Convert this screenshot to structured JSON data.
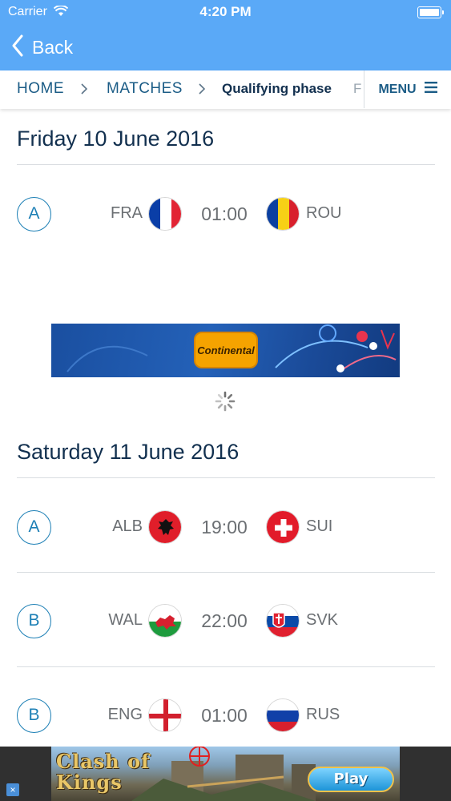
{
  "status_bar": {
    "carrier": "Carrier",
    "time": "4:20 PM"
  },
  "nav": {
    "back_label": "Back"
  },
  "breadcrumb": {
    "items": [
      "HOME",
      "MATCHES",
      "Qualifying phase",
      "F"
    ],
    "menu_label": "MENU"
  },
  "days": [
    {
      "date": "Friday 10 June 2016",
      "matches": [
        {
          "group": "A",
          "home": "FRA",
          "time": "01:00",
          "away": "ROU"
        }
      ]
    },
    {
      "date": "Saturday 11 June 2016",
      "matches": [
        {
          "group": "A",
          "home": "ALB",
          "time": "19:00",
          "away": "SUI"
        },
        {
          "group": "B",
          "home": "WAL",
          "time": "22:00",
          "away": "SVK"
        },
        {
          "group": "B",
          "home": "ENG",
          "time": "01:00",
          "away": "RUS"
        }
      ]
    }
  ],
  "ads": {
    "banner_top": {
      "brand": "Continental"
    },
    "banner_bottom": {
      "title": "Clash of Kings",
      "cta": "Play"
    }
  },
  "colors": {
    "accent": "#5aa9f7",
    "group_badge": "#1c7fb5",
    "breadcrumb_text": "#1b5c86",
    "title_text": "#12304f"
  },
  "icons": [
    "wifi-icon",
    "battery-icon",
    "back-chevron-icon",
    "chevron-right-icon",
    "hamburger-menu-icon",
    "loading-spinner-icon"
  ]
}
